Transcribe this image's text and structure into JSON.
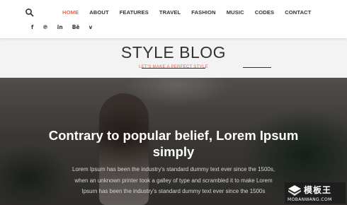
{
  "header": {
    "nav": [
      "HOME",
      "ABOUT",
      "FEATURES",
      "TRAVEL",
      "FASHION",
      "MUSIC",
      "CODES",
      "CONTACT"
    ],
    "active_index": 0,
    "social": [
      {
        "name": "facebook-icon",
        "glyph": "f"
      },
      {
        "name": "pinterest-icon",
        "glyph": "℗"
      },
      {
        "name": "linkedin-icon",
        "glyph": "in"
      },
      {
        "name": "behance-icon",
        "glyph": "Bē"
      },
      {
        "name": "vimeo-icon",
        "glyph": "v"
      }
    ]
  },
  "brand": {
    "title": "STYLE BLOG",
    "tagline": "LET'S MAKE A PERFECT STYLE"
  },
  "hero": {
    "headline": "Contrary to popular belief, Lorem Ipsum simply",
    "body": "Lorem Ipsum has been the industry's standard dummy text ever since the 1500s, when an unknown printer took a galley of type and scrambled it to make Lorem Ipsum has been the industry's standard dummy text ever since the 1500s"
  },
  "watermark": {
    "cn": "模板王",
    "en": "MOBANWANG.COM"
  },
  "colors": {
    "accent": "#e8674f",
    "text": "#333333",
    "band": "#f3f3f3"
  }
}
